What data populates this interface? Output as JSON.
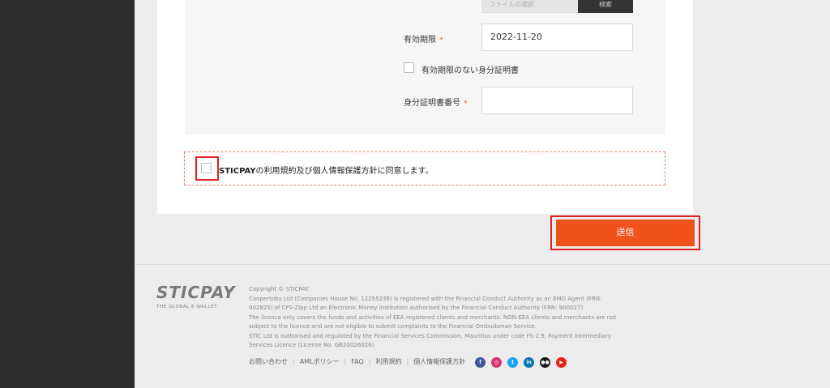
{
  "form": {
    "file_field_placeholder": "ファイルの選択",
    "file_button_label": "検索",
    "expiry": {
      "label": "有効期限",
      "required_mark": "*",
      "value": "2022-11-20"
    },
    "no_expiry_checkbox_label": "有効期限のない身分証明書",
    "id_number": {
      "label": "身分証明書番号",
      "required_mark": "*",
      "value": ""
    }
  },
  "agreement": {
    "brand": "STICPAY",
    "text": "の利用規約及び個人情報保護方針に同意します。"
  },
  "submit_label": "送信",
  "footer": {
    "logo_text": "STICPAY",
    "logo_tagline": "THE GLOBAL E-WALLET",
    "legal_lines": [
      "Copyright © STICPAY.",
      "Coopertoby Ltd (Companies House No. 12255239) is registered with the Financial Conduct Authority as an EMD Agent (FRN:",
      "902825) of CFS-Zipp Ltd an Electronic Money Institution authorised by the Financial Conduct Authority (FRN: 900027)",
      "The licence only covers the funds and activities of EEA registered clients and merchants. NON-EEA clients and merchants are not",
      "subject to the licence and are not eligible to submit complaints to the Financial Ombudsman Service.",
      "STIC Ltd is authorised and regulated by the Financial Services Commission, Mauritius under code FS-2.9, Payment Intermediary",
      "Services Licence (License No. GB20026026)"
    ],
    "links": [
      "お問い合わせ",
      "AMLポリシー",
      "FAQ",
      "利用規約",
      "個人情報保護方針"
    ],
    "social": [
      {
        "name": "facebook-icon",
        "glyph": "f",
        "color": "#3b5998"
      },
      {
        "name": "instagram-icon",
        "glyph": "◎",
        "color": "#d6336c"
      },
      {
        "name": "twitter-icon",
        "glyph": "t",
        "color": "#1da1f2"
      },
      {
        "name": "linkedin-icon",
        "glyph": "in",
        "color": "#0077b5"
      },
      {
        "name": "medium-icon",
        "glyph": "●●",
        "color": "#1a1a1a"
      },
      {
        "name": "youtube-icon",
        "glyph": "▶",
        "color": "#e62117"
      }
    ]
  }
}
